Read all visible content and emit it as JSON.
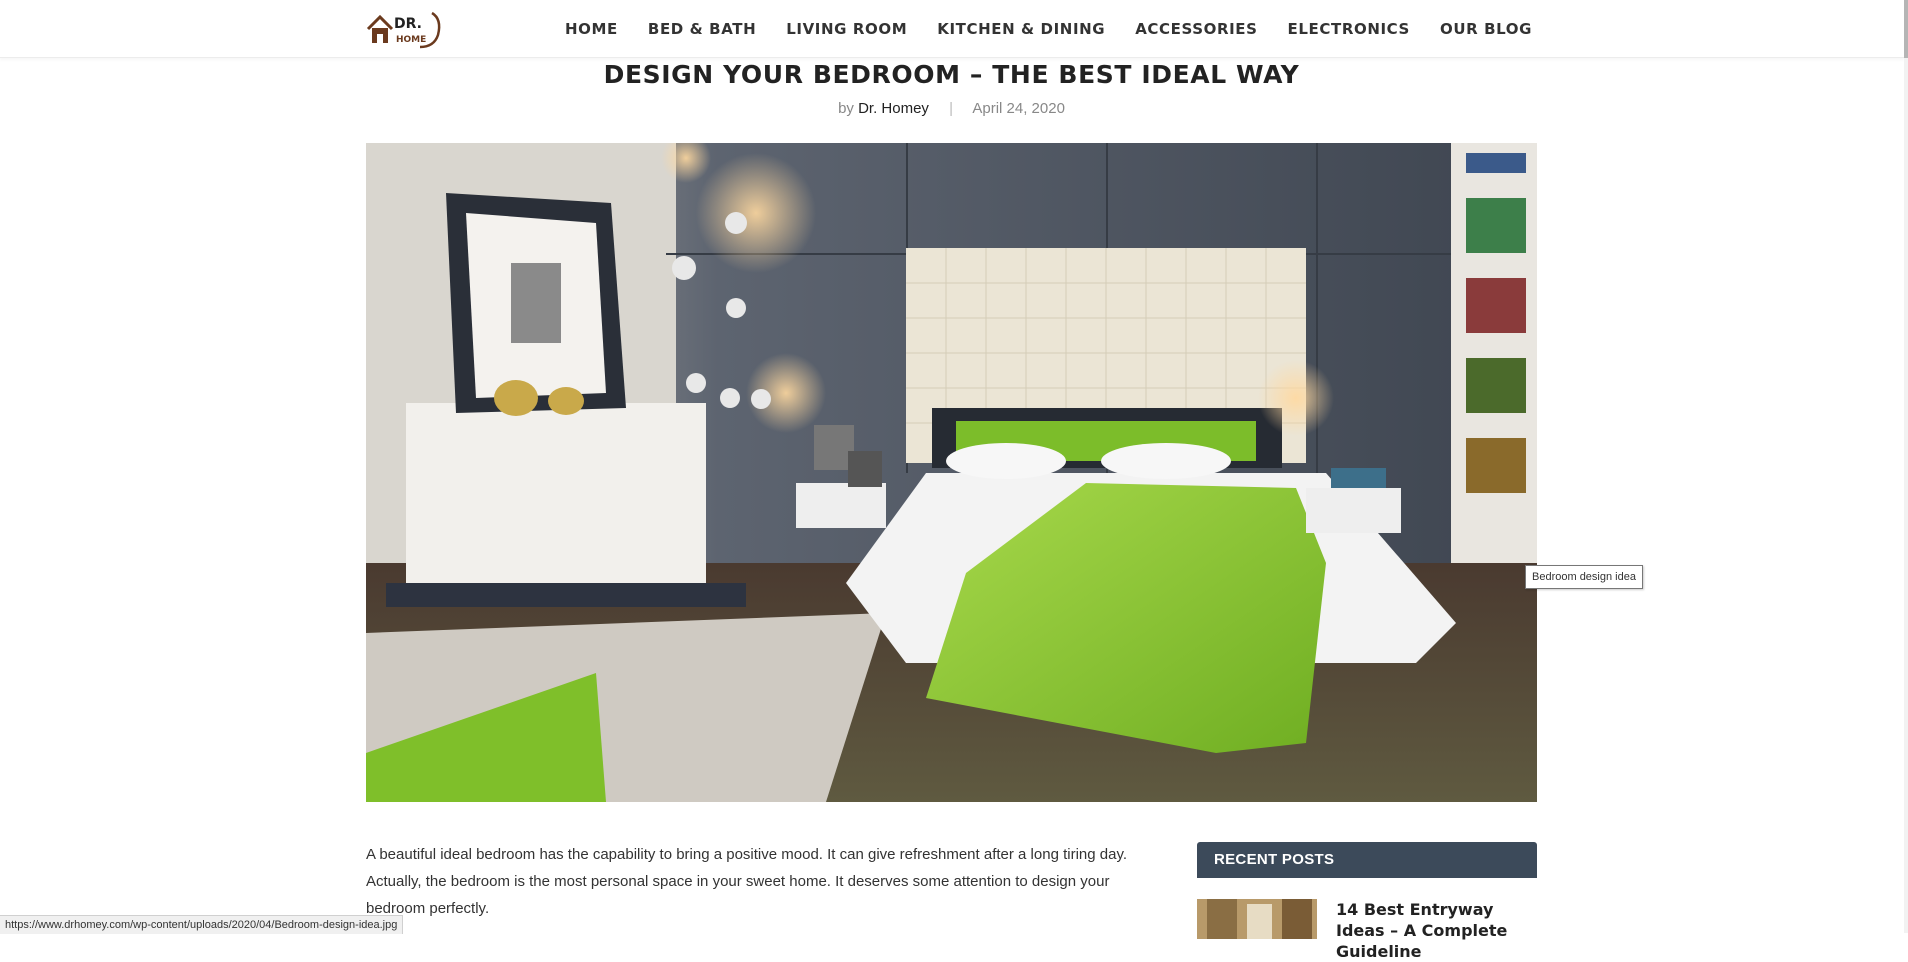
{
  "header": {
    "logo_text_top": "DR.",
    "logo_text_bottom": "HOME",
    "nav": [
      "HOME",
      "BED & BATH",
      "LIVING ROOM",
      "KITCHEN & DINING",
      "ACCESSORIES",
      "ELECTRONICS",
      "OUR BLOG"
    ]
  },
  "article": {
    "title": "DESIGN YOUR BEDROOM – THE BEST IDEAL WAY",
    "by": "by",
    "author": "Dr. Homey",
    "separator": "|",
    "date": "April 24, 2020",
    "image_tooltip": "Bedroom design idea",
    "paragraph": "A beautiful ideal bedroom has the capability to bring a positive mood. It can give refreshment after a long tiring day. Actually, the bedroom is the most personal space in your sweet home. It deserves some attention to design your bedroom perfectly."
  },
  "sidebar": {
    "recent_posts_heading": "RECENT POSTS",
    "post_title": "14 Best Entryway Ideas – A Complete Guideline"
  },
  "statusbar": {
    "url": "https://www.drhomey.com/wp-content/uploads/2020/04/Bedroom-design-idea.jpg"
  },
  "colors": {
    "accent_green": "#8cc63f",
    "widget_bg": "#3c4a5a",
    "logo_brown": "#6b3a1e"
  }
}
